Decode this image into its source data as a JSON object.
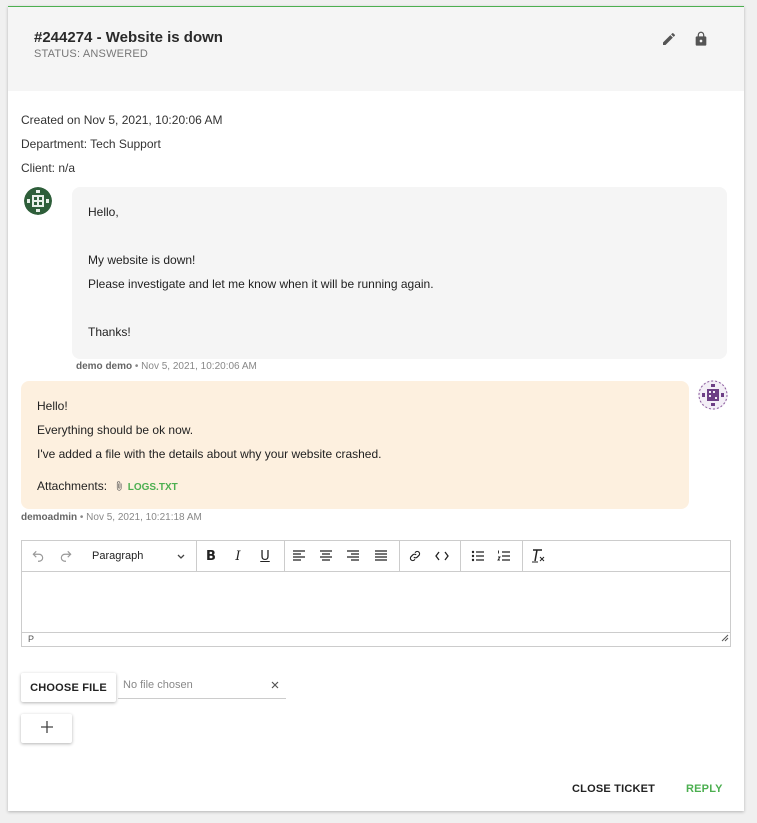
{
  "ticket": {
    "title": "#244274 - Website is down",
    "status": "STATUS: ANSWERED"
  },
  "meta": {
    "created": "Created on Nov 5, 2021, 10:20:06 AM",
    "department": "Department: Tech Support",
    "client": "Client: n/a"
  },
  "messages": [
    {
      "lines": [
        "Hello,",
        "My website is down!",
        "Please investigate and let me know when it will be running again.",
        "Thanks!"
      ],
      "author": "demo demo",
      "time": " • Nov 5, 2021, 10:20:06 AM"
    },
    {
      "lines": [
        "Hello!",
        "Everything should be ok now.",
        "I've added a file with the details about why your website crashed."
      ],
      "attachments_label": "Attachments:",
      "attachment_name": "LOGS.TXT",
      "author": "demoadmin",
      "time": " • Nov 5, 2021, 10:21:18 AM"
    }
  ],
  "editor": {
    "block_format": "Paragraph",
    "status_path": "P"
  },
  "upload": {
    "choose_label": "CHOOSE FILE",
    "no_file": "No file chosen"
  },
  "actions": {
    "close": "CLOSE TICKET",
    "reply": "REPLY"
  },
  "colors": {
    "accent": "#4caf50",
    "staff_bubble": "#fdf0df",
    "client_bubble": "#f5f5f5"
  },
  "icons": [
    "edit-icon",
    "lock-icon",
    "undo-icon",
    "redo-icon",
    "bold-icon",
    "italic-icon",
    "underline-icon",
    "align-left-icon",
    "align-center-icon",
    "align-right-icon",
    "justify-icon",
    "link-icon",
    "code-icon",
    "bullet-list-icon",
    "numbered-list-icon",
    "clear-format-icon",
    "paperclip-icon",
    "plus-icon"
  ]
}
